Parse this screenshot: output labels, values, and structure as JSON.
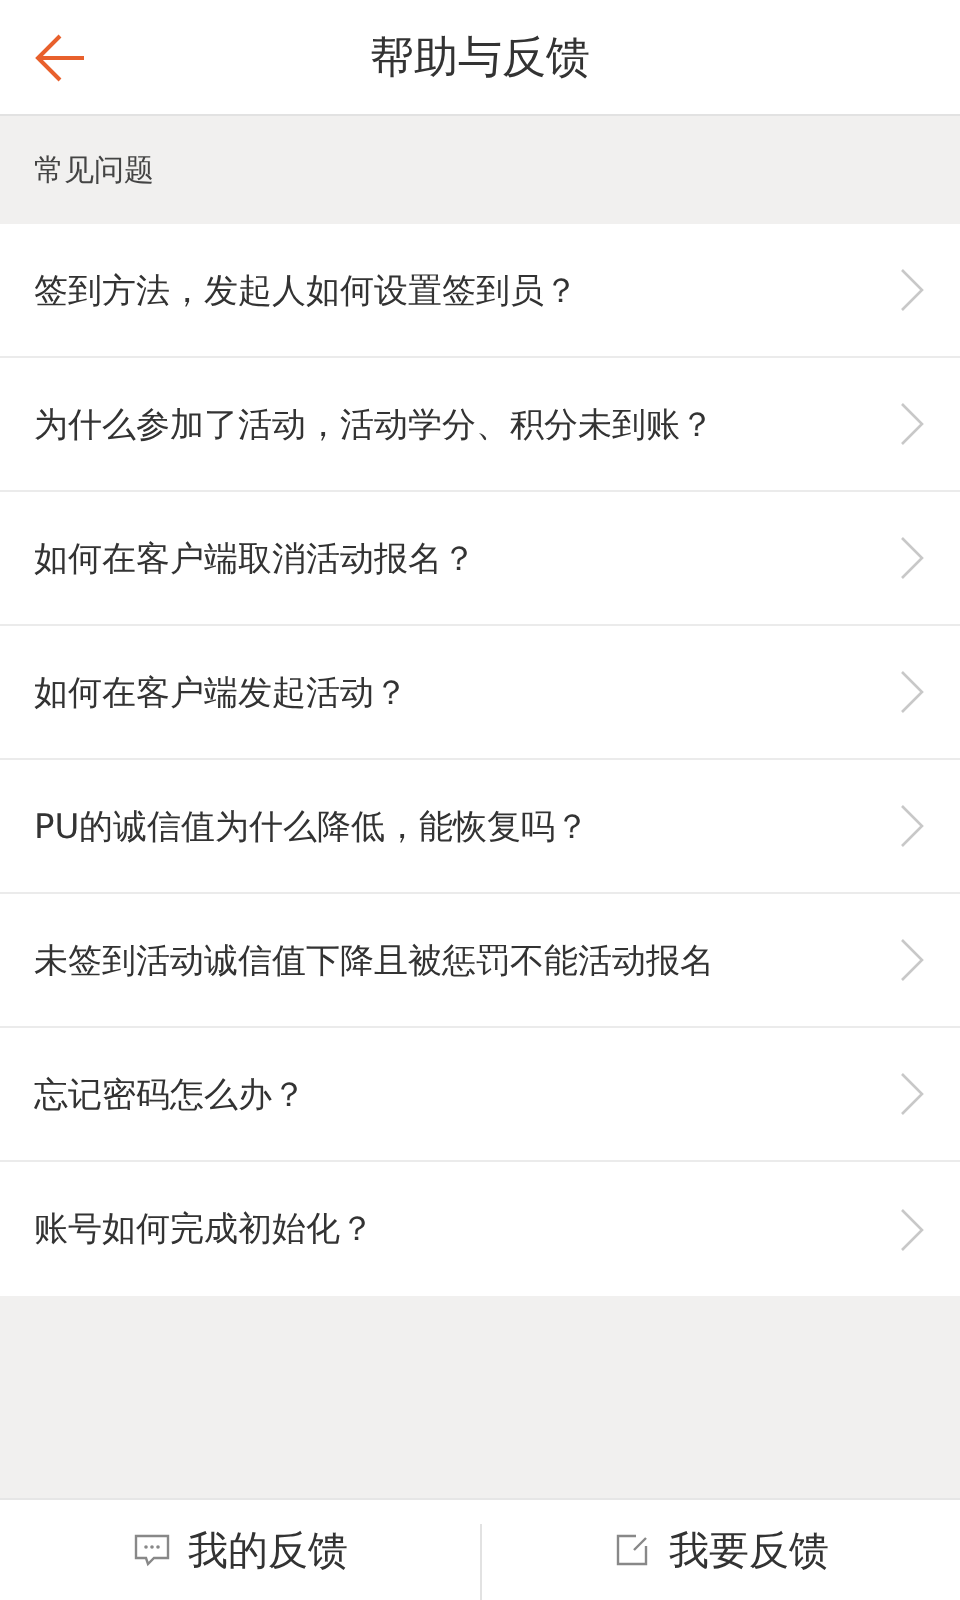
{
  "header": {
    "title": "帮助与反馈"
  },
  "section": {
    "title": "常见问题"
  },
  "questions": [
    {
      "text": "签到方法，发起人如何设置签到员？"
    },
    {
      "text": "为什么参加了活动，活动学分、积分未到账？"
    },
    {
      "text": "如何在客户端取消活动报名？"
    },
    {
      "text": "如何在客户端发起活动？"
    },
    {
      "text": "PU的诚信值为什么降低，能恢复吗？"
    },
    {
      "text": "未签到活动诚信值下降且被惩罚不能活动报名"
    },
    {
      "text": "忘记密码怎么办？"
    },
    {
      "text": "账号如何完成初始化？"
    }
  ],
  "bottom_bar": [
    {
      "kind": "chat",
      "label": "我的反馈"
    },
    {
      "kind": "compose",
      "label": "我要反馈"
    }
  ]
}
